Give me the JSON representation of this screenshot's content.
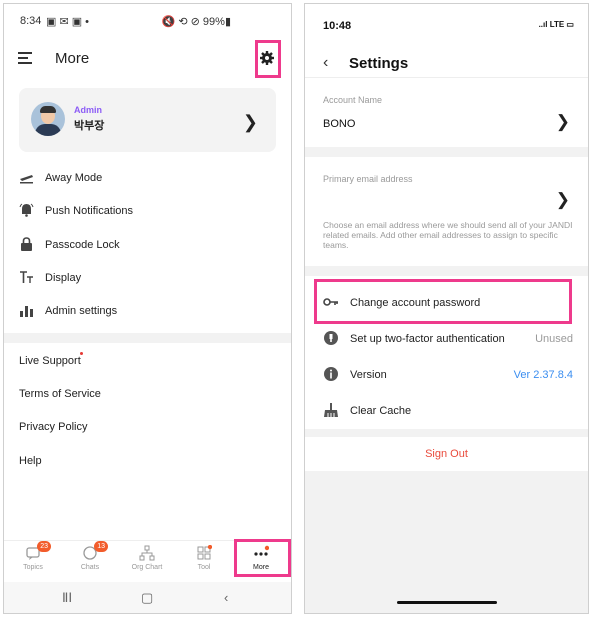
{
  "left": {
    "status": {
      "time": "8:34",
      "icons_left": "▣ ✉ ▣ •",
      "icons_right": "🔇 ⟲ ⊘ 99%▮"
    },
    "header": {
      "title": "More"
    },
    "profile": {
      "role": "Admin",
      "name": "박부장"
    },
    "menu": [
      {
        "label": "Away Mode",
        "icon": "plane-icon"
      },
      {
        "label": "Push Notifications",
        "icon": "bell-icon"
      },
      {
        "label": "Passcode Lock",
        "icon": "lock-icon"
      },
      {
        "label": "Display",
        "icon": "text-size-icon"
      },
      {
        "label": "Admin settings",
        "icon": "bar-chart-icon"
      }
    ],
    "links": [
      "Live Support",
      "Terms of Service",
      "Privacy Policy",
      "Help"
    ],
    "tabs": [
      {
        "label": "Topics",
        "badge": "23",
        "icon": "topics-icon"
      },
      {
        "label": "Chats",
        "badge": "13",
        "icon": "chat-icon"
      },
      {
        "label": "Org Chart",
        "badge": "",
        "icon": "org-chart-icon"
      },
      {
        "label": "Tool",
        "badge": "",
        "icon": "grid-icon"
      },
      {
        "label": "More",
        "badge": "",
        "icon": "more-dots-icon"
      }
    ]
  },
  "right": {
    "status": {
      "time": "10:48",
      "signal": "..ıl LTE ▭"
    },
    "header": {
      "title": "Settings"
    },
    "account_name": {
      "label": "Account Name",
      "value": "BONO"
    },
    "email": {
      "label": "Primary email address",
      "description": "Choose an email address where we should send all of your JANDI related emails. Add other email addresses to assign to specific teams."
    },
    "rows": [
      {
        "label": "Change account password",
        "value": "",
        "icon": "key-icon"
      },
      {
        "label": "Set up two-factor authentication",
        "value": "Unused",
        "icon": "shield-icon"
      },
      {
        "label": "Version",
        "value": "Ver 2.37.8.4",
        "icon": "info-icon"
      },
      {
        "label": "Clear Cache",
        "value": "",
        "icon": "broom-icon"
      }
    ],
    "sign_out": "Sign Out"
  },
  "colors": {
    "highlight": "#ee3a8c",
    "accent": "#f25c2b",
    "version": "#3b8ef0",
    "signout": "#e94b3c",
    "admin": "#8c5cf6"
  }
}
